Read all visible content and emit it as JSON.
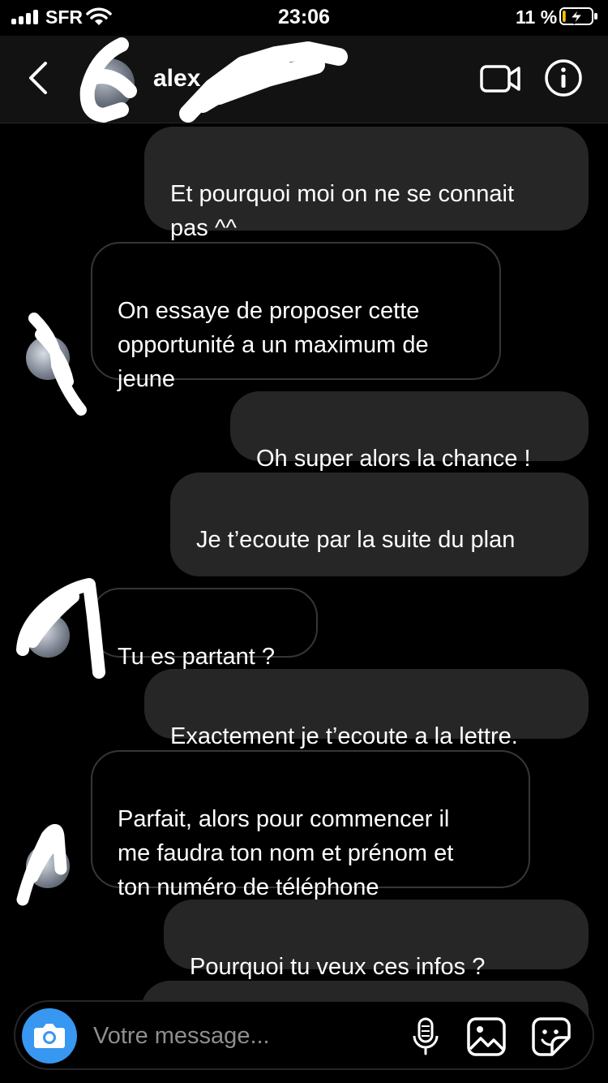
{
  "status_bar": {
    "carrier": "SFR",
    "time": "23:06",
    "battery_percent": "11 %",
    "battery_level": 0.11,
    "charging": true
  },
  "header": {
    "contact_name": "alex",
    "icons": [
      "chevron-left-icon",
      "video-call-icon",
      "info-icon"
    ]
  },
  "messages": [
    {
      "sender": "me",
      "text": "Et pourquoi moi on ne se connait\npas ^^"
    },
    {
      "sender": "them",
      "text": "On essaye de proposer cette\nopportunité a un maximum de\njeune"
    },
    {
      "sender": "me",
      "text": "Oh super alors la chance !"
    },
    {
      "sender": "me",
      "text": "Je t’ecoute par la suite du plan",
      "emoji": "🗺️"
    },
    {
      "sender": "them",
      "text": "Tu es partant ?"
    },
    {
      "sender": "me",
      "text": "Exactement je t’ecoute a la lettre."
    },
    {
      "sender": "them",
      "text": "Parfait, alors pour commencer il\nme faudra ton nom et prénom et\nton numéro de téléphone"
    },
    {
      "sender": "me",
      "text": "Pourquoi tu veux ces infos ?",
      "emoji": "🧐"
    }
  ],
  "composer": {
    "placeholder": "Votre message...",
    "icons": [
      "camera-icon",
      "microphone-icon",
      "gallery-icon",
      "sticker-icon"
    ]
  },
  "colors": {
    "background": "#000000",
    "outgoing_bubble": "#262626",
    "incoming_border": "#363636",
    "camera_button": "#3897f0"
  }
}
